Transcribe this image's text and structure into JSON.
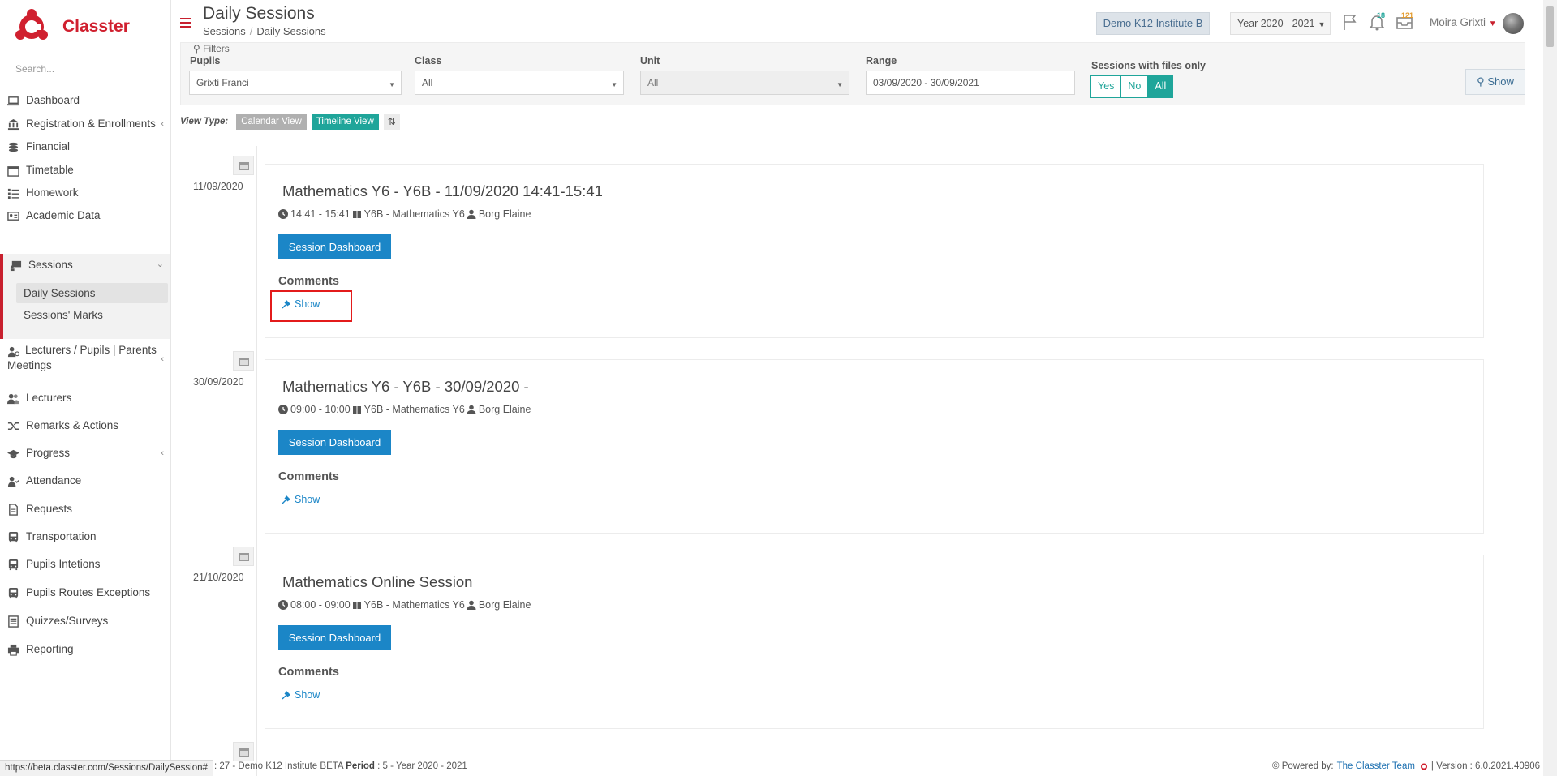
{
  "app": {
    "name": "Classter",
    "brand_color": "#d0202f",
    "accent_teal": "#1fa59a",
    "primary_blue": "#1b86c7"
  },
  "sidebar": {
    "search_placeholder": "Search...",
    "items": [
      {
        "label": "Dashboard",
        "icon": "laptop-icon"
      },
      {
        "label": "Registration & Enrollments",
        "icon": "institution-icon"
      },
      {
        "label": "Financial",
        "icon": "coins-icon"
      },
      {
        "label": "Timetable",
        "icon": "calendar-icon"
      },
      {
        "label": "Homework",
        "icon": "tasks-icon"
      },
      {
        "label": "Academic Data",
        "icon": "id-card-icon"
      },
      {
        "label": "Sessions",
        "icon": "presentation-icon"
      },
      {
        "label": "Lecturers / Pupils | Parents Meetings",
        "icon": "users-gear-icon"
      },
      {
        "label": "Lecturers",
        "icon": "users-icon"
      },
      {
        "label": "Remarks & Actions",
        "icon": "shuffle-icon"
      },
      {
        "label": "Progress",
        "icon": "graduation-cap-icon"
      },
      {
        "label": "Attendance",
        "icon": "user-check-icon"
      },
      {
        "label": "Requests",
        "icon": "file-icon"
      },
      {
        "label": "Transportation",
        "icon": "bus-icon"
      },
      {
        "label": "Pupils Intetions",
        "icon": "bus-icon"
      },
      {
        "label": "Pupils Routes Exceptions",
        "icon": "bus-icon"
      },
      {
        "label": "Quizzes/Surveys",
        "icon": "list-icon"
      },
      {
        "label": "Reporting",
        "icon": "printer-icon"
      }
    ],
    "sessions_sub": [
      "Daily Sessions",
      "Sessions' Marks"
    ]
  },
  "header": {
    "title": "Daily Sessions",
    "breadcrumb": [
      "Sessions",
      "Daily Sessions"
    ],
    "institute": "Demo K12 Institute B",
    "year": "Year 2020 - 2021",
    "notif_count": "18",
    "messages_count": "121",
    "user_name": "Moira Grixti"
  },
  "filters": {
    "title": "Filters",
    "pupils_label": "Pupils",
    "pupils_value": "Grixti Franci",
    "class_label": "Class",
    "class_value": "All",
    "unit_label": "Unit",
    "unit_value": "All",
    "range_label": "Range",
    "range_value": "03/09/2020 - 30/09/2021",
    "files_label": "Sessions with files only",
    "files_options": [
      "Yes",
      "No",
      "All"
    ],
    "files_selected": "All",
    "show_button": "Show"
  },
  "view_type": {
    "label": "View Type:",
    "calendar": "Calendar View",
    "timeline": "Timeline View"
  },
  "sessions": [
    {
      "date": "11/09/2020",
      "title": "Mathematics Y6 - Y6B - 11/09/2020 14:41-15:41",
      "time": "14:41 - 15:41",
      "subject": "Y6B - Mathematics Y6",
      "lecturer": "Borg Elaine",
      "dashboard_label": "Session Dashboard",
      "comments_label": "Comments",
      "show_label": "Show"
    },
    {
      "date": "30/09/2020",
      "title": "Mathematics Y6 - Y6B - 30/09/2020 -",
      "time": "09:00 - 10:00",
      "subject": "Y6B - Mathematics Y6",
      "lecturer": "Borg Elaine",
      "dashboard_label": "Session Dashboard",
      "comments_label": "Comments",
      "show_label": "Show"
    },
    {
      "date": "21/10/2020",
      "title": "Mathematics Online Session",
      "time": "08:00 - 09:00",
      "subject": "Y6B - Mathematics Y6",
      "lecturer": "Borg Elaine",
      "dashboard_label": "Session Dashboard",
      "comments_label": "Comments",
      "show_label": "Show"
    }
  ],
  "footer": {
    "url": "https://beta.classter.com/Sessions/DailySession#",
    "left_text": ": 27 - Demo K12 Institute BETA",
    "period_label": "Period",
    "period_value": ": 5 - Year 2020 - 2021",
    "powered_by": "Powered by:",
    "team": "The Classter Team",
    "version": "| Version : 6.0.2021.40906"
  }
}
